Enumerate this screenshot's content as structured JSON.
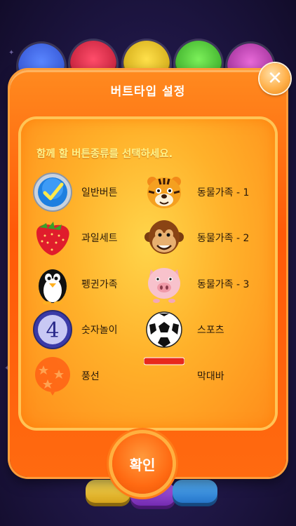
{
  "dialog": {
    "title": "버트타입 설정",
    "instruction": "함께 할 버튼종류를 선택하세요.",
    "confirm_label": "확인"
  },
  "options": [
    {
      "label": "일반버튼",
      "icon": "checkmark-button-icon",
      "selected": true
    },
    {
      "label": "동물가족 - 1",
      "icon": "tiger-icon"
    },
    {
      "label": "과일세트",
      "icon": "strawberry-icon"
    },
    {
      "label": "동물가족 - 2",
      "icon": "monkey-icon"
    },
    {
      "label": "펭귄가족",
      "icon": "penguin-icon"
    },
    {
      "label": "동물가족 - 3",
      "icon": "pig-icon"
    },
    {
      "label": "숫자놀이",
      "icon": "number-four-icon"
    },
    {
      "label": "스포츠",
      "icon": "soccer-ball-icon"
    },
    {
      "label": "풍선",
      "icon": "balloon-icon"
    },
    {
      "label": "막대바",
      "icon": "bar-icon"
    }
  ],
  "number_icon_text": "4",
  "colors": {
    "modal_orange": "#ff6a10",
    "inner_yellow": "#ffd54a",
    "instruction_text": "#fff48a"
  }
}
